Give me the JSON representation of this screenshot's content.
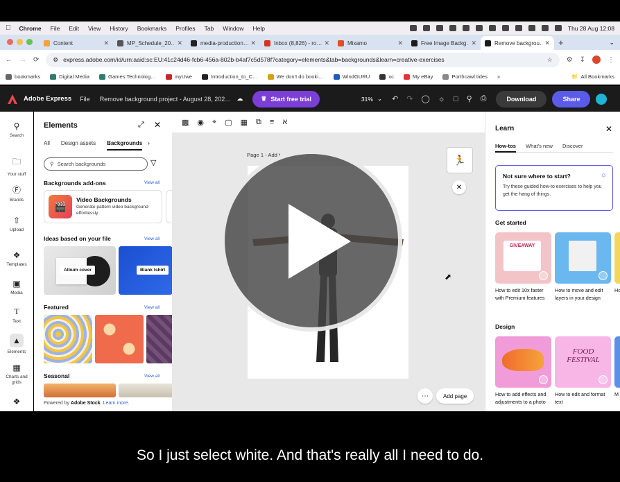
{
  "menubar": {
    "items": [
      "Chrome",
      "File",
      "Edit",
      "View",
      "History",
      "Bookmarks",
      "Profiles",
      "Tab",
      "Window",
      "Help"
    ],
    "clock": "Thu 28 Aug  12:08"
  },
  "tabs": [
    {
      "title": "Content",
      "color": "#f3a33b"
    },
    {
      "title": "MP_Schedule_20…",
      "color": "#555"
    },
    {
      "title": "media-production…",
      "color": "#222"
    },
    {
      "title": "Inbox (8,826) - ro…",
      "color": "#d93025"
    },
    {
      "title": "Mixamo",
      "color": "#e34d26"
    },
    {
      "title": "Free Image Backg…",
      "color": "#1b1b1b"
    },
    {
      "title": "Remove backgrou…",
      "color": "#1b1b1b"
    }
  ],
  "address": {
    "url": "express.adobe.com/id/urn:aaid:sc:EU:41c24d46-fcb6-456a-802b-b4af7c5d578f?category=elements&tab=backgrounds&learn=creative-exercises"
  },
  "bookmarks": [
    {
      "label": "bookmarks",
      "color": "#666"
    },
    {
      "label": "Digital Media",
      "color": "#2e7d6b"
    },
    {
      "label": "Games Technolog…",
      "color": "#2e7d6b"
    },
    {
      "label": "myUwe",
      "color": "#c62828"
    },
    {
      "label": "Introduction_to_C…",
      "color": "#222"
    },
    {
      "label": "We don't do booki…",
      "color": "#d4a017"
    },
    {
      "label": "WindGURU",
      "color": "#1e5bbf"
    },
    {
      "label": "xc",
      "color": "#333"
    },
    {
      "label": "My eBay",
      "color": "#e53238"
    },
    {
      "label": "Porthcawl tides",
      "color": "#888"
    }
  ],
  "bookmarks_all": "All Bookmarks",
  "app": {
    "brand": "Adobe Express",
    "file": "File",
    "project": "Remove background project - August 28, 202…",
    "trial": "Start free trial",
    "zoom": "31%",
    "download": "Download",
    "share": "Share"
  },
  "rail": [
    "Search",
    "Your stuff",
    "Brands",
    "Upload",
    "Templates",
    "Media",
    "Text",
    "Elements",
    "Charts and grids"
  ],
  "elements": {
    "title": "Elements",
    "tabs": [
      "All",
      "Design assets",
      "Backgrounds"
    ],
    "search_placeholder": "Search backgrounds",
    "addons_title": "Backgrounds add-ons",
    "view_all": "View all",
    "addon_title": "Video Backgrounds",
    "addon_desc": "Generate pattern video background effortlessly",
    "ideas_title": "Ideas based on your file",
    "idea1": "Album cover",
    "idea2": "Blank tshirt",
    "featured_title": "Featured",
    "seasonal_title": "Seasonal",
    "powered_prefix": "Powered by",
    "powered_brand": "Adobe Stock",
    "learn_more": "Learn more."
  },
  "canvas": {
    "page_label": "Page 1 - Add t",
    "add_page": "Add page"
  },
  "learn": {
    "title": "Learn",
    "tabs": [
      "How-tos",
      "What's new",
      "Discover"
    ],
    "tip_title": "Not sure where to start?",
    "tip_desc": "Try these guided how-to exercises to help you get the hang of things.",
    "get_started": "Get started",
    "cards1": [
      "How to edit 10x faster with Premium features",
      "How to move and edit layers in your design",
      "Ho"
    ],
    "design": "Design",
    "cards2": [
      "How to add effects and adjustments to a photo",
      "How to edit and format text",
      "M wi"
    ],
    "food_text": "FOOD FESTIVAL",
    "giveaway_text": "GIVEAWAY"
  },
  "caption": "So I just select white. And that's really all I need to do."
}
